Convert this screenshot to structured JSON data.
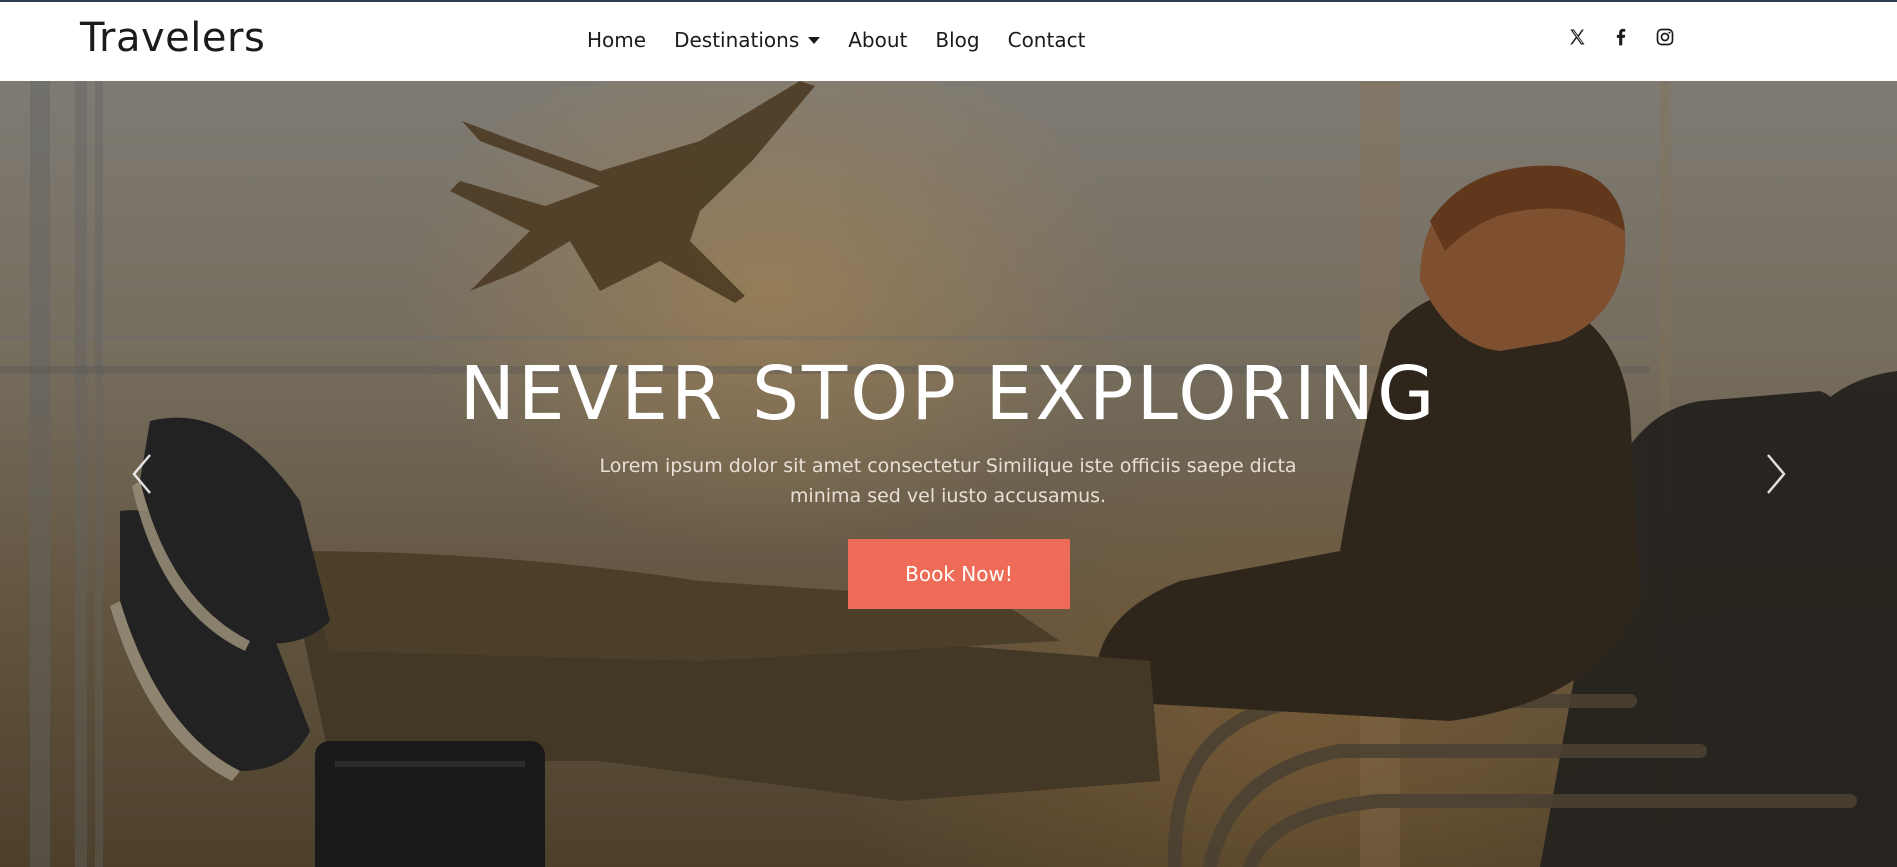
{
  "brand": {
    "name": "Travelers"
  },
  "nav": {
    "items": [
      {
        "label": "Home"
      },
      {
        "label": "Destinations"
      },
      {
        "label": "About"
      },
      {
        "label": "Blog"
      },
      {
        "label": "Contact"
      }
    ]
  },
  "social": {
    "icons": [
      "x-twitter-icon",
      "facebook-icon",
      "instagram-icon"
    ]
  },
  "hero": {
    "headline": "NEVER STOP EXPLORING",
    "lead": "Lorem ipsum dolor sit amet consectetur Similique iste officiis saepe dicta minima sed vel iusto accusamus.",
    "cta_label": "Book Now!",
    "accent_color": "#ee6b58",
    "prev_icon": "chevron-left-icon",
    "next_icon": "chevron-right-icon"
  }
}
